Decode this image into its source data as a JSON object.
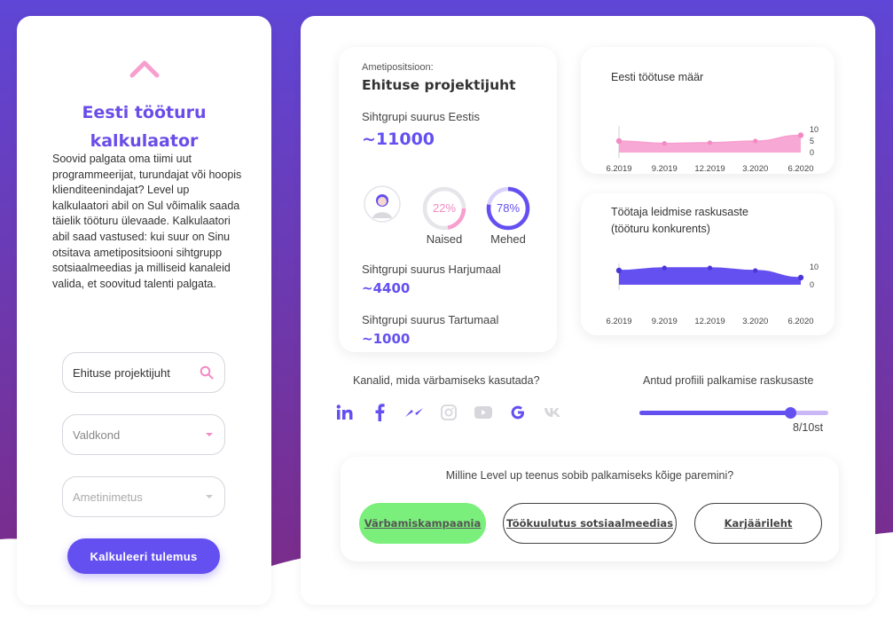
{
  "colors": {
    "purple_top": "#5f46d6",
    "purple_bottom": "#7a2c8a",
    "accent": "#6450f0",
    "pink": "#f79fcf",
    "green": "#7bef7b"
  },
  "left": {
    "title": "Eesti tööturu kalkulaator",
    "description": "Soovid palgata oma tiimi uut programmeerijat, turundajat või hoopis klienditeenindajat? Level up kalkulaatori abil on Sul võimalik saada täielik tööturu ülevaade. Kalkulaatori abil saad vastused: kui suur on Sinu otsitava ametipositsiooni sihtgrupp sotsiaalmeedias ja milliseid kanaleid valida, et soovitud talenti palgata.",
    "search_value": "Ehituse projektijuht",
    "field_valdkond": "Valdkond",
    "field_ametinimetus": "Ametinimetus",
    "button": "Kalkuleeri tulemus"
  },
  "position": {
    "label": "Ametipositsioon:",
    "title": "Ehituse projektijuht",
    "estonia_label": "Sihtgrupi suurus Eestis",
    "estonia_value": "~11000",
    "women_pct": "22%",
    "women_label": "Naised",
    "men_pct": "78%",
    "men_label": "Mehed",
    "harju_label": "Sihtgrupi suurus Harjumaal",
    "harju_value": "~4400",
    "tartu_label": "Sihtgrupi suurus Tartumaal",
    "tartu_value": "~1000"
  },
  "chart_data": [
    {
      "type": "area",
      "title": "Eesti töötuse määr",
      "categories": [
        "6.2019",
        "9.2019",
        "12.2019",
        "3.2020",
        "6.2020"
      ],
      "values": [
        5,
        4,
        4.3,
        5,
        7.5
      ],
      "yticks": [
        "10",
        "5",
        "0"
      ],
      "ylim": [
        0,
        10
      ],
      "color": "#f79fcf"
    },
    {
      "type": "area",
      "title_line1": "Töötaja leidmise raskusaste",
      "title_line2": "(tööturu konkurents)",
      "categories": [
        "6.2019",
        "9.2019",
        "12.2019",
        "3.2020",
        "6.2020"
      ],
      "values": [
        8,
        9.5,
        9.5,
        8,
        4
      ],
      "yticks": [
        "10",
        "0"
      ],
      "ylim": [
        0,
        10
      ],
      "color": "#6450f0"
    }
  ],
  "channels": {
    "title": "Kanalid, mida värbamiseks kasutada?",
    "icons": [
      "linkedin-icon",
      "facebook-icon",
      "messenger-icon",
      "instagram-icon",
      "youtube-icon",
      "google-icon",
      "vk-icon"
    ]
  },
  "difficulty": {
    "title": "Antud profiili palkamise raskusaste",
    "value": 8,
    "max": 10,
    "label": "8/10st"
  },
  "services": {
    "question": "Milline Level up teenus sobib palkamiseks kõige paremini?",
    "options": [
      "Värbamiskampaania",
      "Töökuulutus sotsiaalmeedias",
      "Karjäärileht"
    ]
  }
}
